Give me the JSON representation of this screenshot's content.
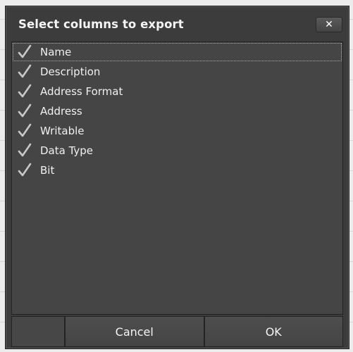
{
  "dialog": {
    "title": "Select columns to export",
    "close_label": "✕"
  },
  "columns": [
    {
      "label": "Name",
      "checked": true
    },
    {
      "label": "Description",
      "checked": true
    },
    {
      "label": "Address Format",
      "checked": true
    },
    {
      "label": "Address",
      "checked": true
    },
    {
      "label": "Writable",
      "checked": true
    },
    {
      "label": "Data Type",
      "checked": true
    },
    {
      "label": "Bit",
      "checked": true
    }
  ],
  "footer": {
    "cancel_label": "Cancel",
    "ok_label": "OK"
  },
  "colors": {
    "dialog_bg": "#3c3c3c",
    "list_bg": "#454545",
    "text": "#f0f0f0",
    "check": "#c8c8c8"
  }
}
